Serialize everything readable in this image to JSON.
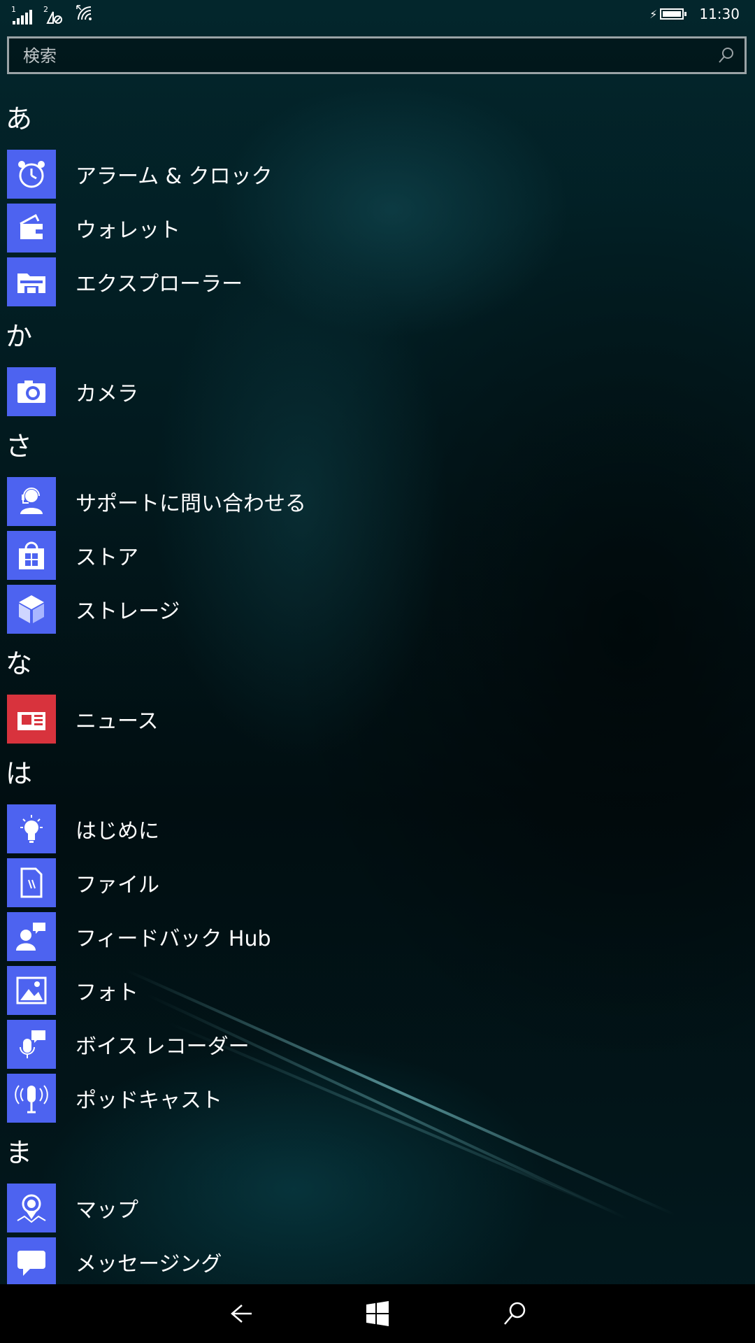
{
  "status_bar": {
    "sim1_label": "1",
    "sim2_label": "2",
    "time": "11:30"
  },
  "search": {
    "placeholder": "検索"
  },
  "sections": [
    {
      "header": "あ",
      "items": [
        {
          "label": "アラーム & クロック",
          "icon": "alarm-clock-icon"
        },
        {
          "label": "ウォレット",
          "icon": "wallet-icon"
        },
        {
          "label": "エクスプローラー",
          "icon": "file-explorer-icon"
        }
      ]
    },
    {
      "header": "か",
      "items": [
        {
          "label": "カメラ",
          "icon": "camera-icon"
        }
      ]
    },
    {
      "header": "さ",
      "items": [
        {
          "label": "サポートに問い合わせる",
          "icon": "support-agent-icon"
        },
        {
          "label": "ストア",
          "icon": "store-bag-icon"
        },
        {
          "label": "ストレージ",
          "icon": "storage-cube-icon"
        }
      ]
    },
    {
      "header": "な",
      "items": [
        {
          "label": "ニュース",
          "icon": "news-icon"
        }
      ]
    },
    {
      "header": "は",
      "items": [
        {
          "label": "はじめに",
          "icon": "lightbulb-icon"
        },
        {
          "label": "ファイル",
          "icon": "file-icon"
        },
        {
          "label": "フィードバック Hub",
          "icon": "feedback-hub-icon"
        },
        {
          "label": "フォト",
          "icon": "photos-icon"
        },
        {
          "label": "ボイス レコーダー",
          "icon": "voice-recorder-icon"
        },
        {
          "label": "ポッドキャスト",
          "icon": "podcast-mic-icon"
        }
      ]
    },
    {
      "header": "ま",
      "items": [
        {
          "label": "マップ",
          "icon": "maps-pin-icon"
        },
        {
          "label": "メッセージング",
          "icon": "messaging-icon"
        }
      ]
    }
  ],
  "navbar": {
    "back_icon": "back-arrow-icon",
    "start_icon": "windows-logo-icon",
    "search_icon": "search-icon"
  },
  "colors": {
    "tile_blue": "#4d63f0",
    "tile_red": "#d8333d",
    "navbar_bg": "#000000"
  }
}
